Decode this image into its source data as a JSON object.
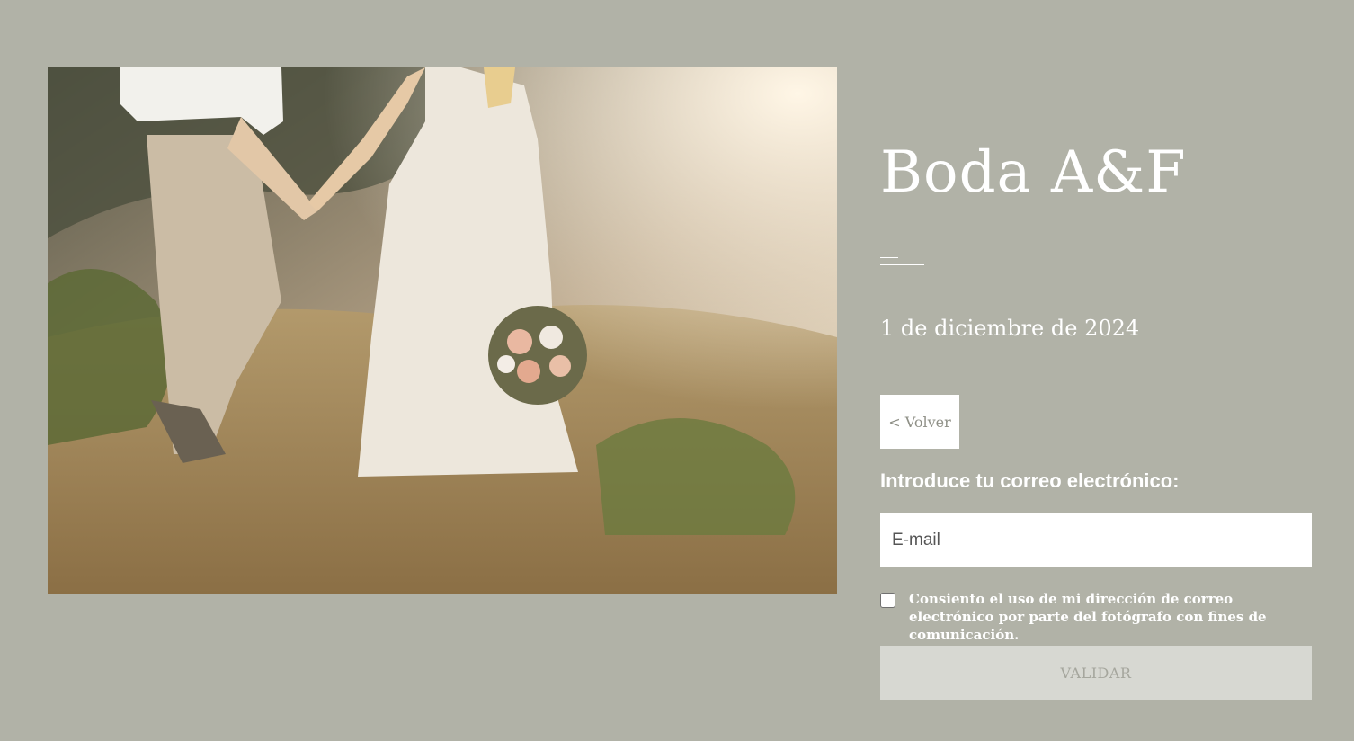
{
  "hero_image": {
    "alt": "couple-walking-in-field-photo"
  },
  "event": {
    "title": "Boda A&F",
    "date": "1 de diciembre de 2024"
  },
  "nav": {
    "back_label": "< Volver"
  },
  "form": {
    "email_label": "Introduce tu correo electrónico:",
    "email_placeholder": "E-mail",
    "email_value": "",
    "consent_text": "Consiento el uso de mi dirección de correo electrónico por parte del fotógrafo con fines de comunicación.",
    "consent_checked": false,
    "submit_label": "VALIDAR"
  },
  "colors": {
    "background": "#b1b2a7",
    "text": "#ffffff",
    "submit_disabled_bg": "#d7d8d2"
  }
}
